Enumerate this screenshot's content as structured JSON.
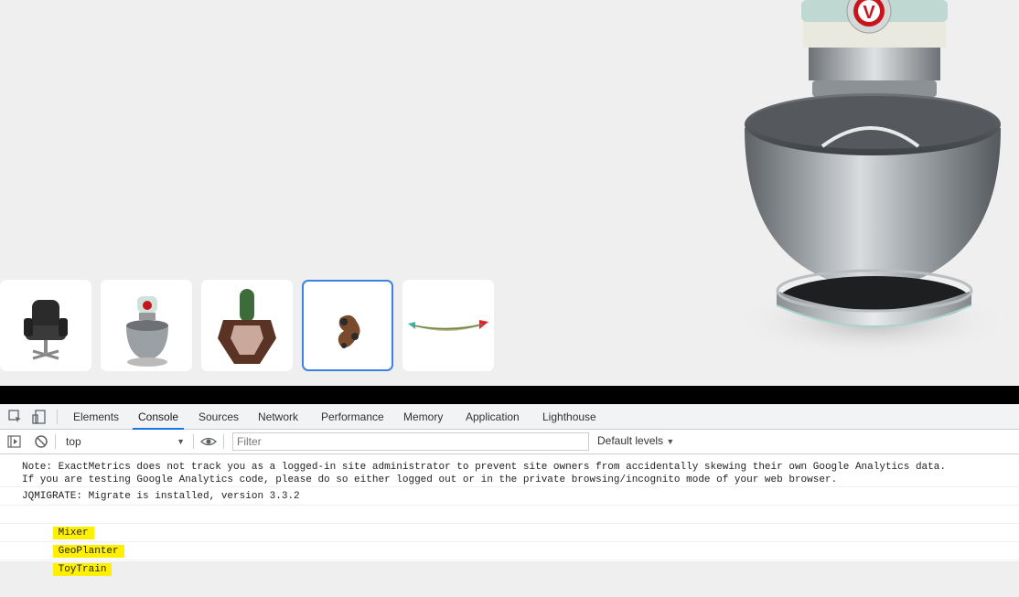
{
  "viewer": {
    "thumbnails": [
      {
        "name": "chair",
        "selected": false
      },
      {
        "name": "mixer",
        "selected": false
      },
      {
        "name": "planter",
        "selected": false
      },
      {
        "name": "toy-train",
        "selected": true
      },
      {
        "name": "canoe",
        "selected": false
      }
    ],
    "logo_letter": "V"
  },
  "devtools": {
    "tabs": [
      "Elements",
      "Console",
      "Sources",
      "Network",
      "Performance",
      "Memory",
      "Application",
      "Lighthouse"
    ],
    "active_tab": "Console",
    "toolbar": {
      "context": "top",
      "filter_placeholder": "Filter",
      "levels": "Default levels"
    },
    "messages": [
      {
        "text": "Note: ExactMetrics does not track you as a logged-in site administrator to prevent site owners from accidentally skewing their own Google Analytics data.\nIf you are testing Google Analytics code, please do so either logged out or in the private browsing/incognito mode of your web browser.",
        "highlight": false
      },
      {
        "text": "JQMIGRATE: Migrate is installed, version 3.3.2",
        "highlight": false
      },
      {
        "text": "Mixer",
        "highlight": true
      },
      {
        "text": "GeoPlanter",
        "highlight": true
      },
      {
        "text": "ToyTrain",
        "highlight": true
      }
    ]
  }
}
